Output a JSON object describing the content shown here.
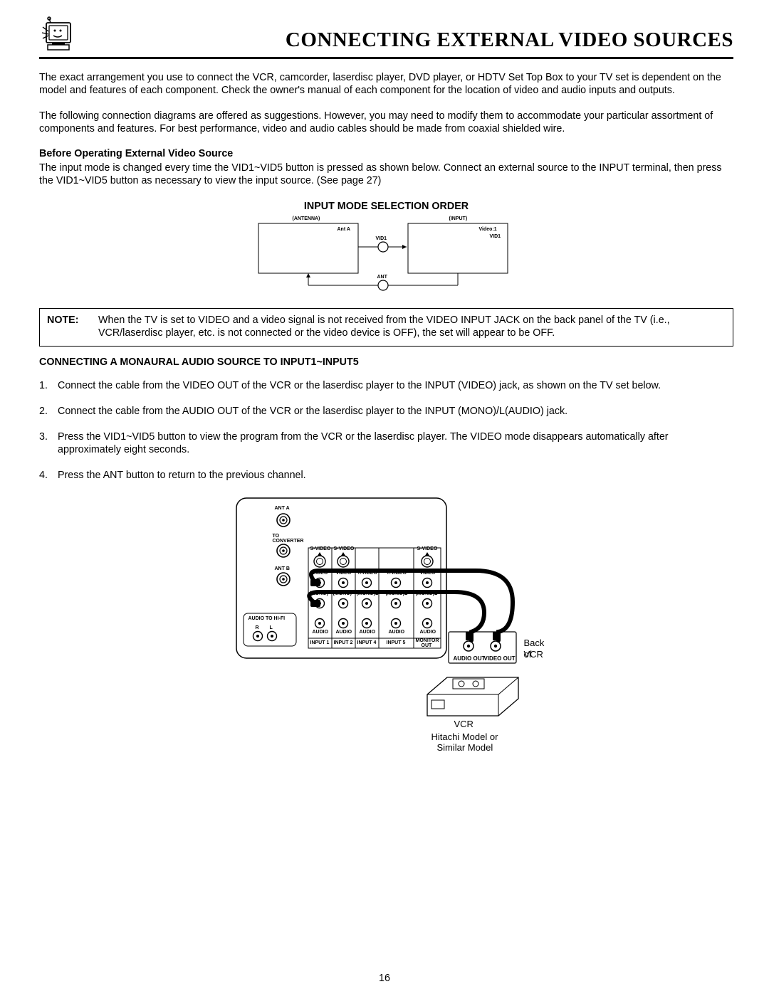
{
  "header": {
    "title": "CONNECTING EXTERNAL VIDEO SOURCES"
  },
  "p1": "The exact arrangement you use to connect the VCR, camcorder, laserdisc player, DVD player, or HDTV Set Top Box to your TV set is dependent on the model and features of each component.  Check the owner's manual of each component for the location of video and audio inputs and outputs.",
  "p2": "The following connection diagrams are offered as suggestions.  However, you may need to modify them to accommodate your particular assortment of components and features.  For best performance, video and audio cables should be made from coaxial shielded wire.",
  "sub1": "Before Operating External Video Source",
  "p3": "The input mode is changed every time the VID1~VID5 button is pressed as shown below.  Connect an external source to the INPUT terminal, then press the VID1~VID5 button as necessary to view the input source.  (See page 27)",
  "inputmode": {
    "title": "INPUT MODE SELECTION ORDER",
    "antenna": "(ANTENNA)",
    "input": "(INPUT)",
    "anta": "Ant A",
    "video1": "Video:1",
    "vid1_left": "VID1",
    "vid1_right": "VID1",
    "ant": "ANT"
  },
  "note": {
    "label": "NOTE:",
    "text": "When the TV is set to VIDEO and a video signal is not received from the VIDEO INPUT JACK on the back panel of the TV (i.e., VCR/laserdisc player, etc. is not connected or the video device is OFF), the set will appear to be OFF."
  },
  "sub2": "CONNECTING A MONAURAL AUDIO SOURCE TO INPUT1~INPUT5",
  "steps": [
    "Connect the cable from the VIDEO OUT of the VCR or the laserdisc player to the INPUT (VIDEO) jack, as shown on the TV set below.",
    "Connect the cable from the AUDIO OUT of the VCR or the laserdisc player to the INPUT (MONO)/L(AUDIO) jack.",
    "Press the VID1~VID5 button to view the program from the VCR or the laserdisc player.  The VIDEO mode disappears automatically after approximately eight seconds.",
    "Press the ANT button to return to the previous channel."
  ],
  "diag": {
    "anta": "ANT A",
    "toconv1": "TO",
    "toconv2": "CONVERTER",
    "antb": "ANT B",
    "audiohifi": "AUDIO TO HI-FI",
    "r": "R",
    "l": "L",
    "svideo": "S-VIDEO",
    "video": "VIDEO",
    "yvideo": "Y/VIDEO",
    "mono": "(MONO)",
    "monoL": "(MONO)L",
    "audio": "AUDIO",
    "input1": "INPUT 1",
    "input2": "INPUT 2",
    "input4": "INPUT 4",
    "input5": "INPUT 5",
    "monout1": "MONITOR",
    "monout2": "OUT",
    "audioout": "AUDIO OUT",
    "videoout": "VIDEO OUT",
    "backof": "Back of",
    "vcr": "VCR",
    "vcr2": "VCR",
    "hitachi1": "Hitachi Model or",
    "hitachi2": "Similar Model"
  },
  "page": "16"
}
